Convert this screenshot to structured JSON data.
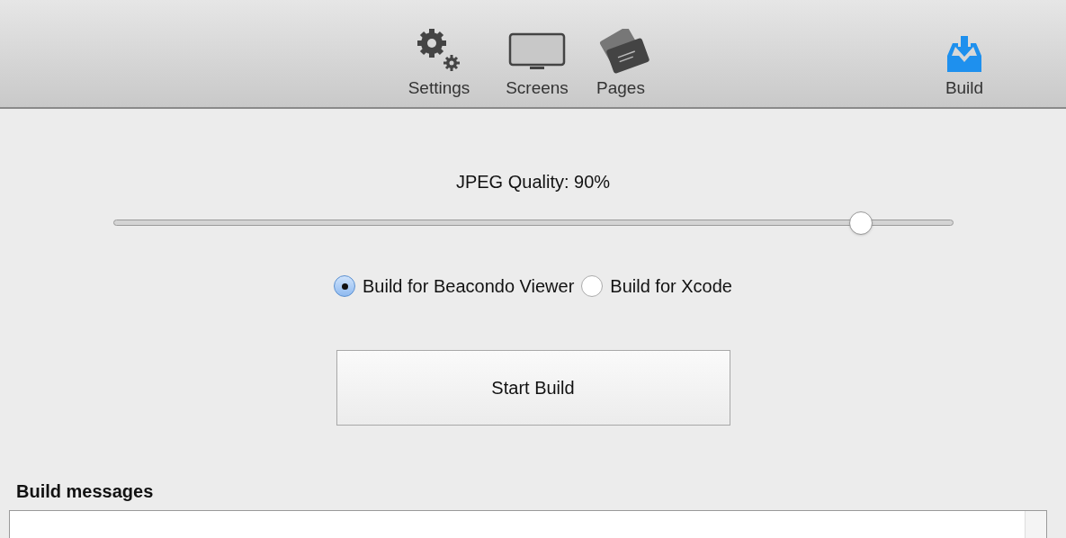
{
  "toolbar": [
    {
      "label": "Settings",
      "kind": "gears",
      "selected": false
    },
    {
      "label": "Screens",
      "kind": "monitor",
      "selected": false
    },
    {
      "label": "Pages",
      "kind": "cards",
      "selected": false
    },
    {
      "label": "Build",
      "kind": "inbox",
      "selected": true
    }
  ],
  "quality": {
    "label": "JPEG Quality: 90%",
    "level": 0.89
  },
  "targets": [
    {
      "label": "Build for Beacondo Viewer",
      "selected": true
    },
    {
      "label": "Build for Xcode",
      "selected": false
    }
  ],
  "start_button": "Start Build",
  "messages": {
    "label": "Build messages"
  }
}
